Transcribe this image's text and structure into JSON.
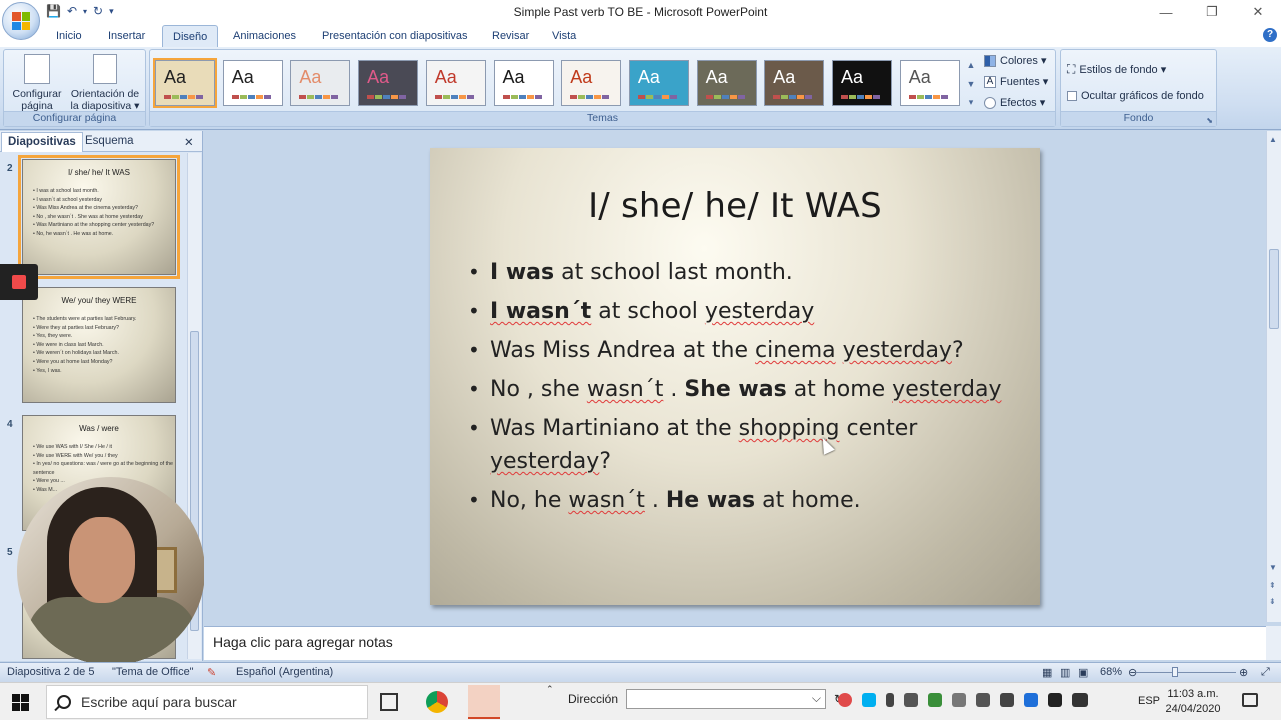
{
  "window": {
    "title": "Simple Past verb TO BE - Microsoft PowerPoint",
    "controls": [
      "—",
      "❐",
      "✕"
    ]
  },
  "ribbon_tabs": [
    {
      "label": "Inicio"
    },
    {
      "label": "Insertar"
    },
    {
      "label": "Diseño",
      "active": true
    },
    {
      "label": "Animaciones"
    },
    {
      "label": "Presentación con diapositivas"
    },
    {
      "label": "Revisar"
    },
    {
      "label": "Vista"
    }
  ],
  "ribbon": {
    "page_setup": {
      "configure_line1": "Configurar",
      "configure_line2": "página",
      "orientation_line1": "Orientación de",
      "orientation_line2": "la diapositiva ▾",
      "group_label": "Configurar página"
    },
    "themes": {
      "group_label": "Temas",
      "items": [
        {
          "label": "Aa",
          "bg": "#e9dcb9",
          "fg": "#222222",
          "selected": true
        },
        {
          "label": "Aa",
          "bg": "#ffffff",
          "fg": "#222222"
        },
        {
          "label": "Aa",
          "bg": "#e9ecef",
          "fg": "#e38c6a"
        },
        {
          "label": "Aa",
          "bg": "#4a4a55",
          "fg": "#e05a8a"
        },
        {
          "label": "Aa",
          "bg": "#f4f4f4",
          "fg": "#c0392b"
        },
        {
          "label": "Aa",
          "bg": "#ffffff",
          "fg": "#1a1a1a"
        },
        {
          "label": "Aa",
          "bg": "#f7f3ee",
          "fg": "#c03a1a"
        },
        {
          "label": "Aa",
          "bg": "#3aa3c9",
          "fg": "#ffffff"
        },
        {
          "label": "Aa",
          "bg": "#6c6a59",
          "fg": "#ffffff"
        },
        {
          "label": "Aa",
          "bg": "#6b5a4a",
          "fg": "#ffffff"
        },
        {
          "label": "Aa",
          "bg": "#111111",
          "fg": "#ffffff"
        },
        {
          "label": "Aa",
          "bg": "#ffffff",
          "fg": "#555555"
        }
      ],
      "colores": "Colores ▾",
      "fuentes": "Fuentes ▾",
      "efectos": "Efectos ▾"
    },
    "fondo": {
      "estilos": "Estilos de fondo ▾",
      "ocultar": "Ocultar gráficos de fondo",
      "group_label": "Fondo"
    }
  },
  "left_pane": {
    "tabs": [
      "Diapositivas",
      "Esquema"
    ],
    "close": "✕",
    "slides": [
      {
        "number": "2",
        "title": "I/ she/ he/ It WAS",
        "lines": [
          "I was at school last month.",
          "I wasn´t at school yesterday",
          "Was Miss Andrea at the cinema yesterday?",
          "No , she wasn´t . She was at home yesterday",
          "Was Martiniano at the shopping center yesterday?",
          "No, he wasn´t . He was at home."
        ]
      },
      {
        "number": "",
        "title": "We/ you/ they WERE",
        "lines": [
          "The students were at parties last February.",
          "Were they at parties last February?",
          "Yes, they were.",
          "We were in class last March.",
          "We weren´t on holidays last March.",
          "Were you at home last Monday?",
          "Yes, I was."
        ]
      },
      {
        "number": "4",
        "title": "Was / were",
        "lines": [
          "We use WAS with I/ She / He / it",
          "We use WERE with We/ you / they",
          "In yes/ no questions: was / were go at the beginning of the sentence",
          "Were you ...",
          "Was M..."
        ]
      },
      {
        "number": "5",
        "title": "",
        "lines": []
      }
    ]
  },
  "slide": {
    "title": "I/ she/ he/ It WAS",
    "bullets": [
      [
        {
          "t": "I was",
          "b": true
        },
        {
          "t": " at school last month."
        }
      ],
      [
        {
          "t": "I wasn´t",
          "b": true,
          "u": true
        },
        {
          "t": " at school "
        },
        {
          "t": "yesterday",
          "u": true
        }
      ],
      [
        {
          "t": "Was Miss Andrea at the "
        },
        {
          "t": "cinema",
          "u": true
        },
        {
          "t": " "
        },
        {
          "t": "yesterday",
          "u": true
        },
        {
          "t": "?"
        }
      ],
      [
        {
          "t": "No , she "
        },
        {
          "t": "wasn´t",
          "u": true
        },
        {
          "t": " . "
        },
        {
          "t": "She was",
          "b": true
        },
        {
          "t": " at home "
        },
        {
          "t": "yesterday",
          "u": true
        }
      ],
      [
        {
          "t": "Was Martiniano at the "
        },
        {
          "t": "shopping",
          "u": true
        },
        {
          "t": " center "
        },
        {
          "t": "yesterday",
          "u": true
        },
        {
          "t": "?"
        }
      ],
      [
        {
          "t": "No, he "
        },
        {
          "t": "wasn´t",
          "u": true
        },
        {
          "t": " . "
        },
        {
          "t": "He was",
          "b": true
        },
        {
          "t": " at home."
        }
      ]
    ]
  },
  "notes": {
    "placeholder": "Haga clic para agregar notas"
  },
  "status": {
    "slide_info": "Diapositiva 2 de 5",
    "theme": "\"Tema de Office\"",
    "language": "Español (Argentina)",
    "zoom": "68%"
  },
  "taskbar": {
    "search_placeholder": "Escribe aquí para buscar",
    "address_label": "Dirección",
    "lang": "ESP",
    "time": "11:03 a.m.",
    "date": "24/04/2020"
  }
}
